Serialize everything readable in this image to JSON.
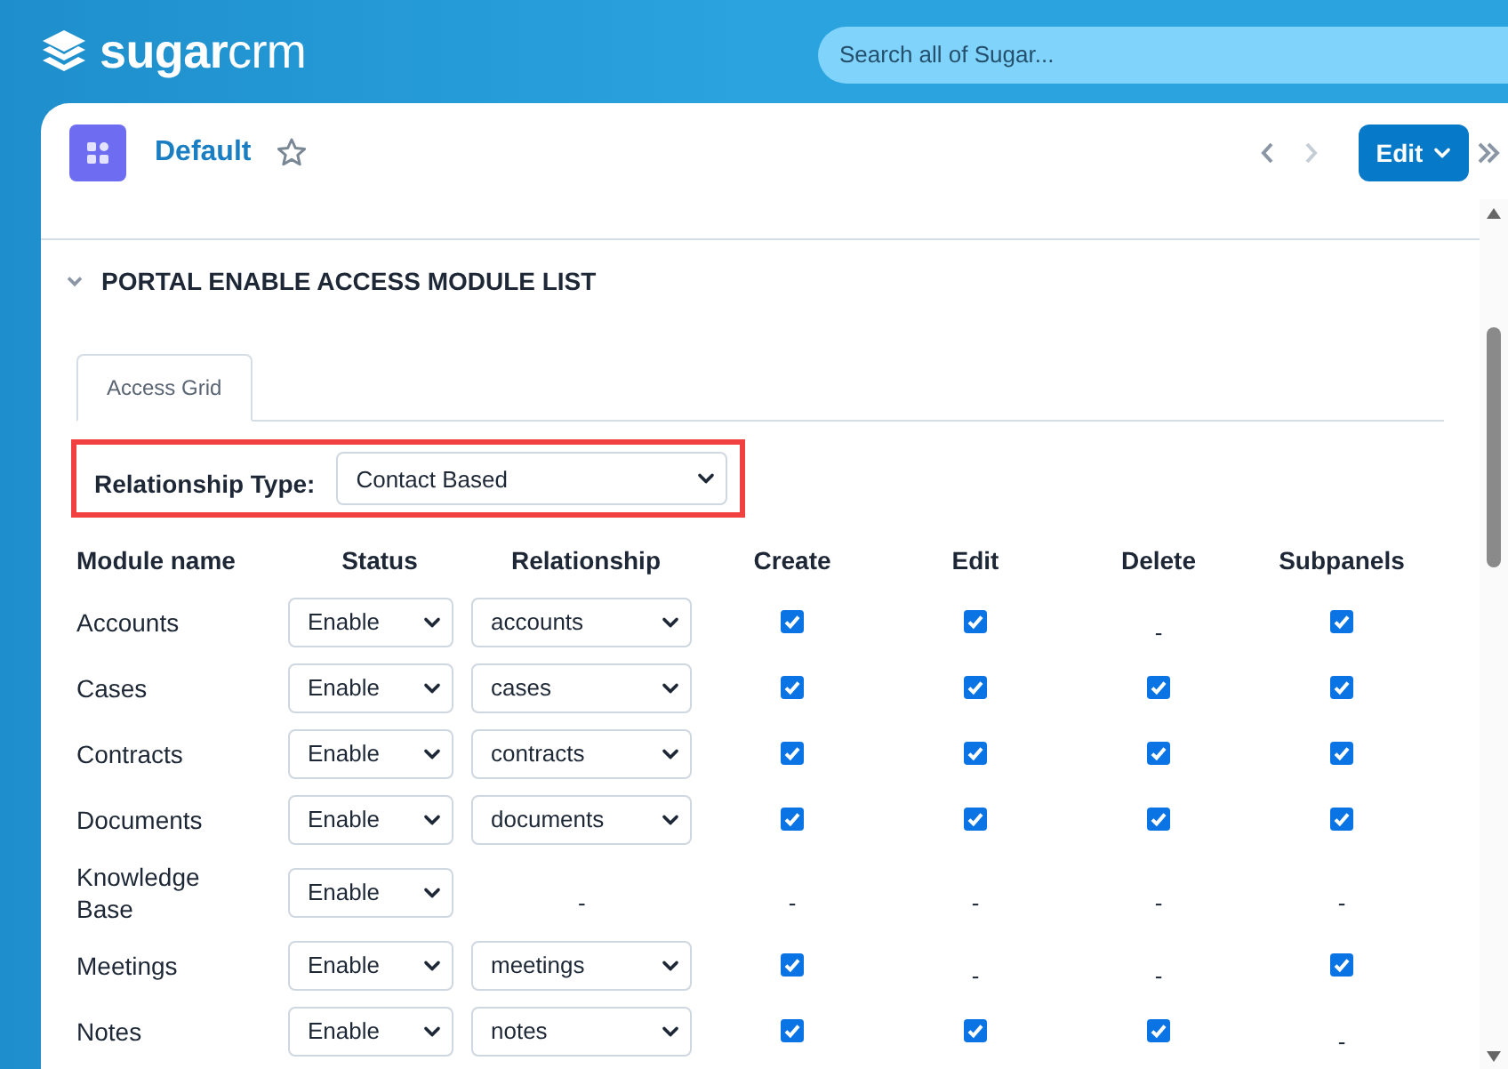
{
  "topbar": {
    "logo": "**sugar**crm",
    "search": {
      "placeholder": "Search all of Sugar..."
    }
  },
  "header": {
    "title": "Default",
    "favorite": false,
    "prev_disabled": false,
    "next_disabled": true,
    "edit_button": "Edit"
  },
  "section": {
    "title": "PORTAL ENABLE ACCESS MODULE LIST",
    "expanded": true
  },
  "tabs": [
    {
      "label": "Access Grid",
      "selected": true
    }
  ],
  "relationship_type": {
    "label": "Relationship Type:",
    "value": "Contact Based"
  },
  "table": {
    "columns": [
      "Module name",
      "Status",
      "Relationship",
      "Create",
      "Edit",
      "Delete",
      "Subpanels"
    ],
    "rows": [
      {
        "module": "Accounts",
        "status": "Enable",
        "relationship": {
          "kind": "select",
          "value": "accounts"
        },
        "create": {
          "kind": "checkbox",
          "checked": true
        },
        "edit": {
          "kind": "checkbox",
          "checked": true
        },
        "delete": {
          "kind": "text",
          "text": "-"
        },
        "subpanels": {
          "kind": "checkbox",
          "checked": true
        }
      },
      {
        "module": "Cases",
        "status": "Enable",
        "relationship": {
          "kind": "select",
          "value": "cases"
        },
        "create": {
          "kind": "checkbox",
          "checked": true
        },
        "edit": {
          "kind": "checkbox",
          "checked": true
        },
        "delete": {
          "kind": "checkbox",
          "checked": true
        },
        "subpanels": {
          "kind": "checkbox",
          "checked": true
        }
      },
      {
        "module": "Contracts",
        "status": "Enable",
        "relationship": {
          "kind": "select",
          "value": "contracts"
        },
        "create": {
          "kind": "checkbox",
          "checked": true
        },
        "edit": {
          "kind": "checkbox",
          "checked": true
        },
        "delete": {
          "kind": "checkbox",
          "checked": true
        },
        "subpanels": {
          "kind": "checkbox",
          "checked": true
        }
      },
      {
        "module": "Documents",
        "status": "Enable",
        "relationship": {
          "kind": "select",
          "value": "documents"
        },
        "create": {
          "kind": "checkbox",
          "checked": true
        },
        "edit": {
          "kind": "checkbox",
          "checked": true
        },
        "delete": {
          "kind": "checkbox",
          "checked": true
        },
        "subpanels": {
          "kind": "checkbox",
          "checked": true
        }
      },
      {
        "module": "Knowledge Base",
        "status": "Enable",
        "relationship": {
          "kind": "text",
          "text": "-"
        },
        "create": {
          "kind": "text",
          "text": "-"
        },
        "edit": {
          "kind": "text",
          "text": "-"
        },
        "delete": {
          "kind": "text",
          "text": "-"
        },
        "subpanels": {
          "kind": "text",
          "text": "-"
        }
      },
      {
        "module": "Meetings",
        "status": "Enable",
        "relationship": {
          "kind": "select",
          "value": "meetings"
        },
        "create": {
          "kind": "checkbox",
          "checked": true
        },
        "edit": {
          "kind": "text",
          "text": "-"
        },
        "delete": {
          "kind": "text",
          "text": "-"
        },
        "subpanels": {
          "kind": "checkbox",
          "checked": true
        }
      },
      {
        "module": "Notes",
        "status": "Enable",
        "relationship": {
          "kind": "select",
          "value": "notes"
        },
        "create": {
          "kind": "checkbox",
          "checked": true
        },
        "edit": {
          "kind": "checkbox",
          "checked": true
        },
        "delete": {
          "kind": "checkbox",
          "checked": true
        },
        "subpanels": {
          "kind": "text",
          "text": "-"
        }
      }
    ]
  }
}
